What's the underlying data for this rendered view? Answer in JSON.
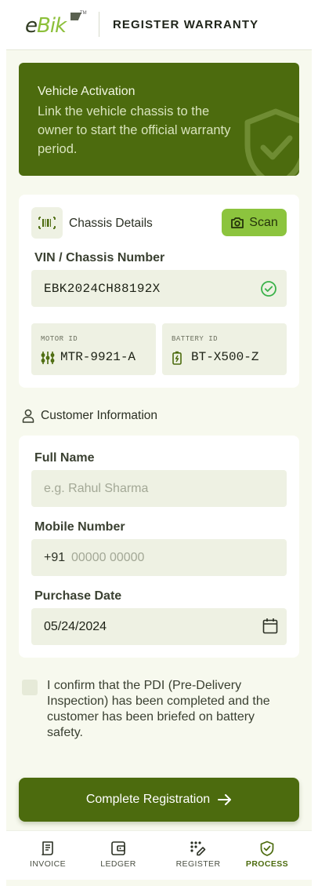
{
  "header": {
    "logo_text_e": "e",
    "logo_text_bik": "Bik",
    "logo_tm": "TM",
    "title": "REGISTER WARRANTY"
  },
  "banner": {
    "title": "Vehicle Activation",
    "text": "Link the vehicle chassis to the owner to start the official warranty period.",
    "icon": "shield-check-icon"
  },
  "chassis": {
    "title": "Chassis Details",
    "icon": "barcode-icon",
    "scan_label": "Scan",
    "scan_icon": "camera-icon",
    "vin_label": "VIN / Chassis Number",
    "vin_value": "EBK2024CH88192X",
    "vin_status_icon": "check-circle-icon",
    "motor": {
      "label": "MOTOR ID",
      "value": "MTR-9921-A",
      "icon": "motor-icon"
    },
    "battery": {
      "label": "BATTERY ID",
      "value": "BT-X500-Z",
      "icon": "battery-icon"
    }
  },
  "customer": {
    "heading": "Customer Information",
    "heading_icon": "user-icon",
    "name_label": "Full Name",
    "name_placeholder": "e.g. Rahul Sharma",
    "mobile_label": "Mobile Number",
    "mobile_prefix": "+91",
    "mobile_placeholder": "00000 00000",
    "date_label": "Purchase Date",
    "date_value": "05/24/2024",
    "date_icon": "calendar-icon"
  },
  "confirm": {
    "checked": false,
    "text": "I confirm that the PDI (Pre-Delivery Inspection) has been completed and the customer has been briefed on battery safety."
  },
  "primary_button": {
    "label": "Complete Registration",
    "icon": "arrow-right-icon"
  },
  "nav": {
    "items": [
      {
        "label": "INVOICE",
        "icon": "receipt-icon",
        "active": false
      },
      {
        "label": "LEDGER",
        "icon": "wallet-icon",
        "active": false
      },
      {
        "label": "REGISTER",
        "icon": "register-icon",
        "active": false
      },
      {
        "label": "PROCESS",
        "icon": "shield-check-icon",
        "active": true
      }
    ]
  },
  "colors": {
    "brand_dark": "#4c6b0e",
    "brand_light": "#8cc43e",
    "background": "#f7f9ee",
    "field": "#eef1e3",
    "success": "#3bb24a"
  }
}
